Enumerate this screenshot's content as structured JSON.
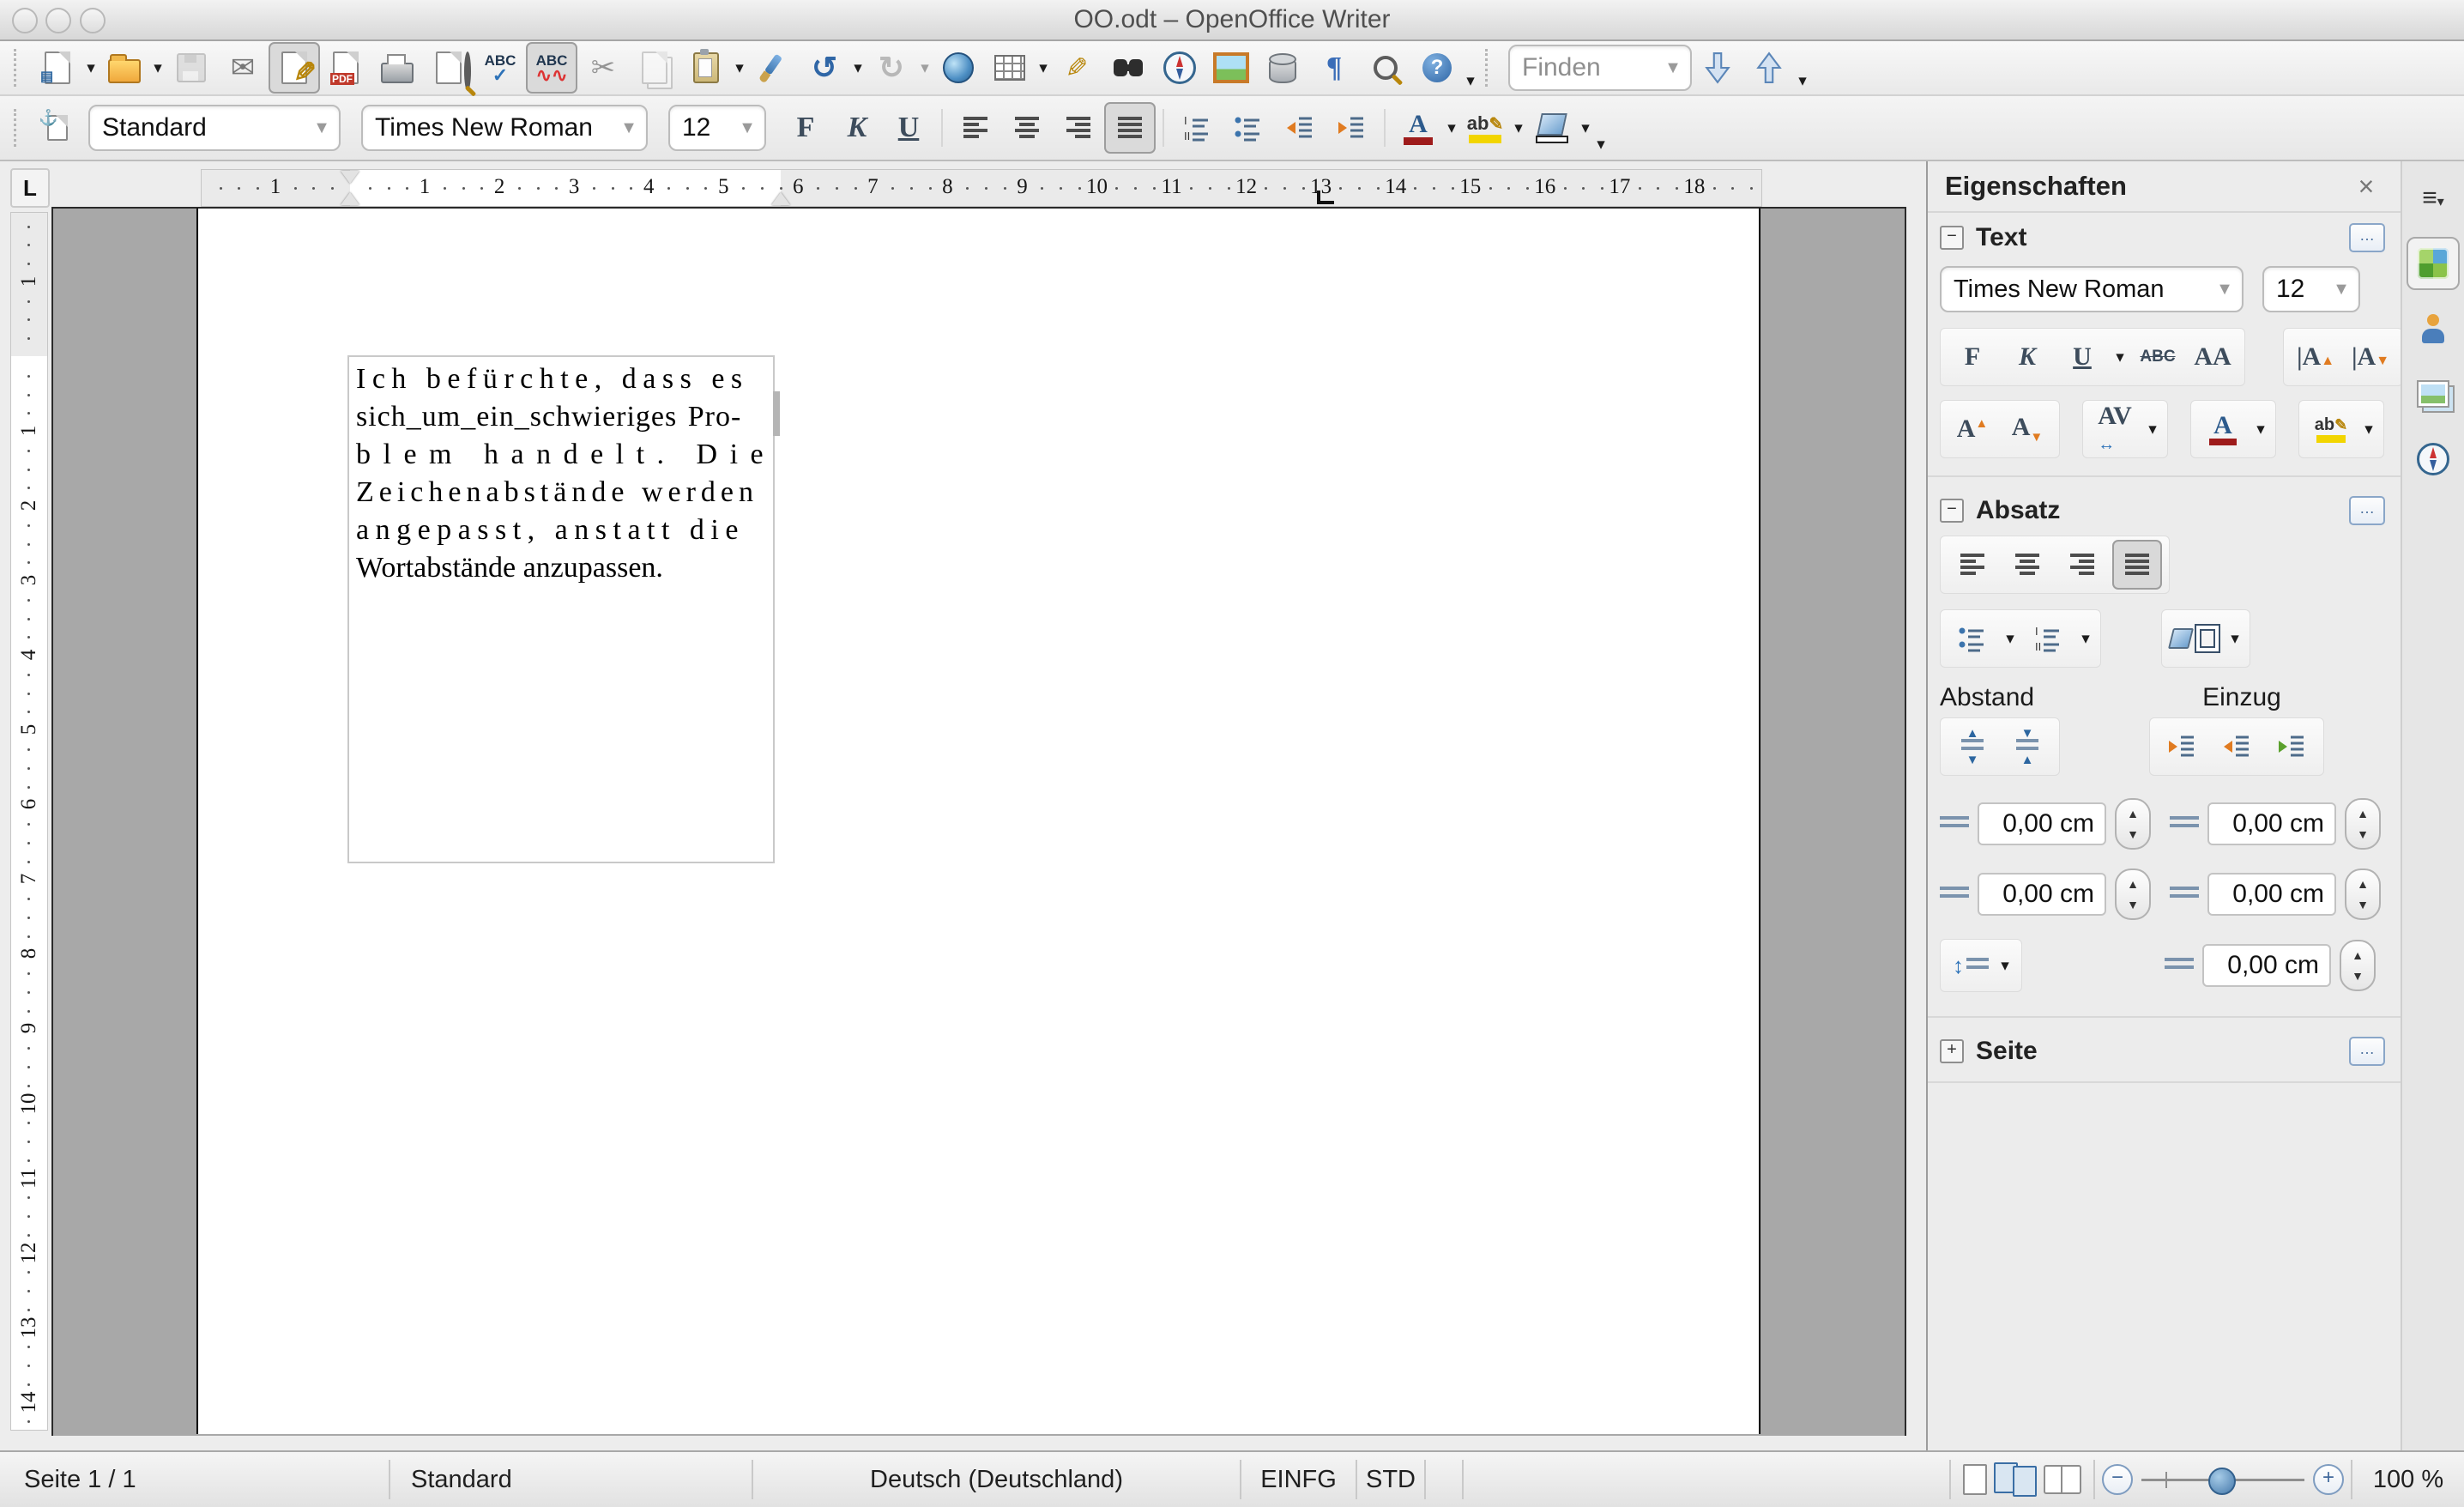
{
  "window": {
    "title": "OO.odt – OpenOffice Writer"
  },
  "toolbar_standard": {
    "items": [
      "new",
      "open",
      "save",
      "email",
      "edit-file",
      "export-pdf",
      "print",
      "page-preview",
      "spellcheck",
      "auto-spellcheck",
      "cut",
      "copy",
      "paste",
      "format-paintbrush",
      "undo",
      "redo",
      "hyperlink",
      "table",
      "draw-functions",
      "find-replace",
      "navigator",
      "gallery",
      "data-sources",
      "formatting-marks",
      "zoom",
      "help"
    ],
    "find_placeholder": "Finden"
  },
  "toolbar_formatting": {
    "paragraph_style": "Standard",
    "font_name": "Times New Roman",
    "font_size": "12",
    "bold_label": "F",
    "italic_label": "K",
    "underline_label": "U"
  },
  "rulers": {
    "h": {
      "pre": [
        "1"
      ],
      "nums": [
        "1",
        "2",
        "3",
        "4",
        "5",
        "6",
        "7",
        "8",
        "9",
        "10",
        "11",
        "12",
        "13",
        "14",
        "15",
        "16",
        "17",
        "18"
      ]
    },
    "v": {
      "pre": [
        "1"
      ],
      "nums": [
        "1",
        "2",
        "3",
        "4",
        "5",
        "6",
        "7",
        "8",
        "9",
        "10",
        "11",
        "12",
        "13",
        "14"
      ]
    }
  },
  "doc": {
    "lines": [
      "Ich befürchte, dass es",
      "sich_um_ein_schwieriges Pro-",
      "blem handelt.  Die",
      "Zeichenabstände werden",
      "angepasst, anstatt die",
      "Wortabstände anzupassen."
    ]
  },
  "sidebar": {
    "title": "Eigenschaften",
    "close_label": "×",
    "text_section": {
      "label": "Text",
      "font_name": "Times New Roman",
      "font_size": "12",
      "bold_label": "F",
      "italic_label": "K",
      "underline_label": "U",
      "strike_label": "ABC",
      "case_label": "AA",
      "super_label": "A",
      "sub_label": "A",
      "kerning_label": "AV",
      "font_color_label": "A",
      "highlight_label": "ab"
    },
    "paragraph_section": {
      "label": "Absatz",
      "spacing_label": "Abstand",
      "indent_label": "Einzug",
      "above_spacing": "0,00 cm",
      "below_spacing": "0,00 cm",
      "before_indent": "0,00 cm",
      "after_indent": "0,00 cm",
      "first_line_indent": "0,00 cm"
    },
    "page_section": {
      "label": "Seite"
    }
  },
  "statusbar": {
    "page": "Seite 1 / 1",
    "page_style": "Standard",
    "language": "Deutsch (Deutschland)",
    "insert_mode": "EINFG",
    "selection_mode": "STD",
    "zoom_level": "100 %"
  }
}
